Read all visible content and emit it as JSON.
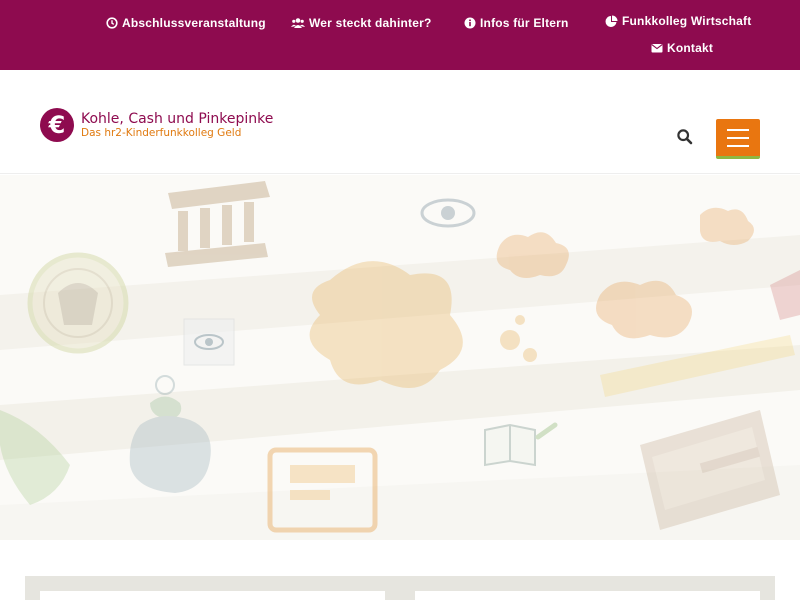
{
  "topnav": {
    "items": [
      {
        "label": "Abschlussveranstaltung",
        "icon": "clock-icon"
      },
      {
        "label": "Wer steckt dahinter?",
        "icon": "users-icon"
      },
      {
        "label": "Infos für Eltern",
        "icon": "info-icon"
      },
      {
        "label": "Funkkolleg Wirtschaft",
        "icon": "pie-chart-icon"
      },
      {
        "label": "Kontakt",
        "icon": "envelope-icon"
      }
    ]
  },
  "header": {
    "logo_symbol": "€",
    "logo_title": "Kohle, Cash und Pinkepinke",
    "logo_subtitle": "Das hr2-Kinderfunkkolleg Geld"
  },
  "colors": {
    "brand": "#8e0b4f",
    "accent_orange": "#e97610",
    "accent_green": "#8fb842"
  }
}
